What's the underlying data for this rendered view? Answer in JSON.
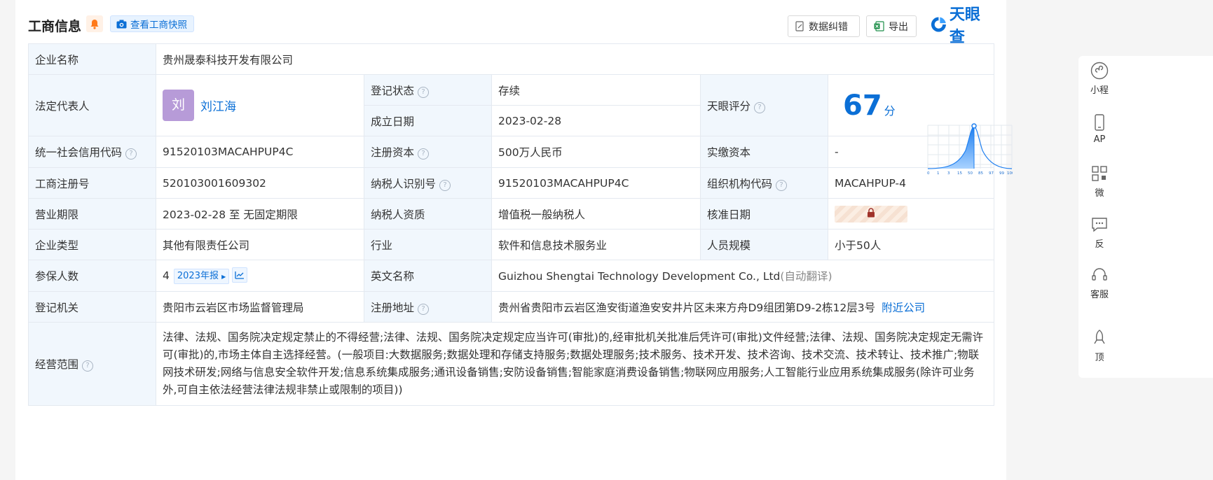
{
  "header": {
    "title": "工商信息",
    "snapshot_label": "查看工商快照",
    "correct_label": "数据纠错",
    "export_label": "导出",
    "brand": "天眼查"
  },
  "rows": {
    "company_name": {
      "label": "企业名称",
      "value": "贵州晟泰科技开发有限公司"
    },
    "legal_rep": {
      "label": "法定代表人",
      "avatar_char": "刘",
      "name": "刘江海"
    },
    "reg_status": {
      "label": "登记状态",
      "value": "存续"
    },
    "found_date": {
      "label": "成立日期",
      "value": "2023-02-28"
    },
    "tianyan_score": {
      "label": "天眼评分",
      "score": "67",
      "unit": "分",
      "chart_ticks": [
        "0",
        "1",
        "3",
        "15",
        "50",
        "85",
        "97",
        "99",
        "100"
      ]
    },
    "credit_code": {
      "label": "统一社会信用代码",
      "value": "91520103MACAHPUP4C"
    },
    "reg_capital": {
      "label": "注册资本",
      "value": "500万人民币"
    },
    "paid_capital": {
      "label": "实缴资本",
      "value": "-"
    },
    "reg_number": {
      "label": "工商注册号",
      "value": "520103001609302"
    },
    "taxpayer_id": {
      "label": "纳税人识别号",
      "value": "91520103MACAHPUP4C"
    },
    "org_code": {
      "label": "组织机构代码",
      "value": "MACAHPUP-4"
    },
    "business_term": {
      "label": "营业期限",
      "value": "2023-02-28 至 无固定期限"
    },
    "taxpayer_qual": {
      "label": "纳税人资质",
      "value": "增值税一般纳税人"
    },
    "approval_date": {
      "label": "核准日期"
    },
    "company_type": {
      "label": "企业类型",
      "value": "其他有限责任公司"
    },
    "industry": {
      "label": "行业",
      "value": "软件和信息技术服务业"
    },
    "staff_size": {
      "label": "人员规模",
      "value": "小于50人"
    },
    "insured": {
      "label": "参保人数",
      "value": "4",
      "report": "2023年报"
    },
    "english_name": {
      "label": "英文名称",
      "value": "Guizhou Shengtai Technology Development Co., Ltd",
      "note": "(自动翻译)"
    },
    "reg_authority": {
      "label": "登记机关",
      "value": "贵阳市云岩区市场监督管理局"
    },
    "reg_address": {
      "label": "注册地址",
      "value": "贵州省贵阳市云岩区渔安街道渔安安井片区未来方舟D9组团第D9-2栋12层3号",
      "nearby": "附近公司"
    },
    "scope": {
      "label": "经营范围",
      "value": "法律、法规、国务院决定规定禁止的不得经营;法律、法规、国务院决定规定应当许可(审批)的,经审批机关批准后凭许可(审批)文件经营;法律、法规、国务院决定规定无需许可(审批)的,市场主体自主选择经营。(一般项目:大数据服务;数据处理和存储支持服务;数据处理服务;技术服务、技术开发、技术咨询、技术交流、技术转让、技术推广;物联网技术研发;网络与信息安全软件开发;信息系统集成服务;通讯设备销售;安防设备销售;智能家庭消费设备销售;物联网应用服务;人工智能行业应用系统集成服务(除许可业务外,可自主依法经营法律法规非禁止或限制的项目))"
    }
  },
  "sidebar": {
    "items": [
      {
        "label": "小程"
      },
      {
        "label": "AP"
      },
      {
        "label": "微"
      },
      {
        "label": "反"
      },
      {
        "label": "客服"
      },
      {
        "label": "顶"
      }
    ]
  }
}
